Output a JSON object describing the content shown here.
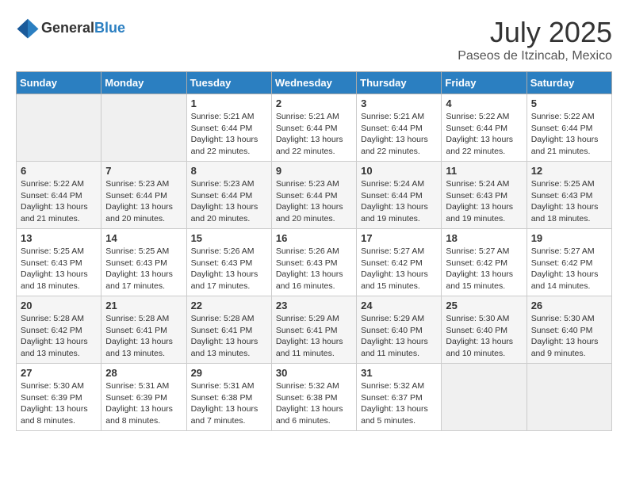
{
  "header": {
    "logo_general": "General",
    "logo_blue": "Blue",
    "month": "July 2025",
    "location": "Paseos de Itzincab, Mexico"
  },
  "weekdays": [
    "Sunday",
    "Monday",
    "Tuesday",
    "Wednesday",
    "Thursday",
    "Friday",
    "Saturday"
  ],
  "weeks": [
    [
      {
        "day": "",
        "sunrise": "",
        "sunset": "",
        "daylight": ""
      },
      {
        "day": "",
        "sunrise": "",
        "sunset": "",
        "daylight": ""
      },
      {
        "day": "1",
        "sunrise": "Sunrise: 5:21 AM",
        "sunset": "Sunset: 6:44 PM",
        "daylight": "Daylight: 13 hours and 22 minutes."
      },
      {
        "day": "2",
        "sunrise": "Sunrise: 5:21 AM",
        "sunset": "Sunset: 6:44 PM",
        "daylight": "Daylight: 13 hours and 22 minutes."
      },
      {
        "day": "3",
        "sunrise": "Sunrise: 5:21 AM",
        "sunset": "Sunset: 6:44 PM",
        "daylight": "Daylight: 13 hours and 22 minutes."
      },
      {
        "day": "4",
        "sunrise": "Sunrise: 5:22 AM",
        "sunset": "Sunset: 6:44 PM",
        "daylight": "Daylight: 13 hours and 22 minutes."
      },
      {
        "day": "5",
        "sunrise": "Sunrise: 5:22 AM",
        "sunset": "Sunset: 6:44 PM",
        "daylight": "Daylight: 13 hours and 21 minutes."
      }
    ],
    [
      {
        "day": "6",
        "sunrise": "Sunrise: 5:22 AM",
        "sunset": "Sunset: 6:44 PM",
        "daylight": "Daylight: 13 hours and 21 minutes."
      },
      {
        "day": "7",
        "sunrise": "Sunrise: 5:23 AM",
        "sunset": "Sunset: 6:44 PM",
        "daylight": "Daylight: 13 hours and 20 minutes."
      },
      {
        "day": "8",
        "sunrise": "Sunrise: 5:23 AM",
        "sunset": "Sunset: 6:44 PM",
        "daylight": "Daylight: 13 hours and 20 minutes."
      },
      {
        "day": "9",
        "sunrise": "Sunrise: 5:23 AM",
        "sunset": "Sunset: 6:44 PM",
        "daylight": "Daylight: 13 hours and 20 minutes."
      },
      {
        "day": "10",
        "sunrise": "Sunrise: 5:24 AM",
        "sunset": "Sunset: 6:44 PM",
        "daylight": "Daylight: 13 hours and 19 minutes."
      },
      {
        "day": "11",
        "sunrise": "Sunrise: 5:24 AM",
        "sunset": "Sunset: 6:43 PM",
        "daylight": "Daylight: 13 hours and 19 minutes."
      },
      {
        "day": "12",
        "sunrise": "Sunrise: 5:25 AM",
        "sunset": "Sunset: 6:43 PM",
        "daylight": "Daylight: 13 hours and 18 minutes."
      }
    ],
    [
      {
        "day": "13",
        "sunrise": "Sunrise: 5:25 AM",
        "sunset": "Sunset: 6:43 PM",
        "daylight": "Daylight: 13 hours and 18 minutes."
      },
      {
        "day": "14",
        "sunrise": "Sunrise: 5:25 AM",
        "sunset": "Sunset: 6:43 PM",
        "daylight": "Daylight: 13 hours and 17 minutes."
      },
      {
        "day": "15",
        "sunrise": "Sunrise: 5:26 AM",
        "sunset": "Sunset: 6:43 PM",
        "daylight": "Daylight: 13 hours and 17 minutes."
      },
      {
        "day": "16",
        "sunrise": "Sunrise: 5:26 AM",
        "sunset": "Sunset: 6:43 PM",
        "daylight": "Daylight: 13 hours and 16 minutes."
      },
      {
        "day": "17",
        "sunrise": "Sunrise: 5:27 AM",
        "sunset": "Sunset: 6:42 PM",
        "daylight": "Daylight: 13 hours and 15 minutes."
      },
      {
        "day": "18",
        "sunrise": "Sunrise: 5:27 AM",
        "sunset": "Sunset: 6:42 PM",
        "daylight": "Daylight: 13 hours and 15 minutes."
      },
      {
        "day": "19",
        "sunrise": "Sunrise: 5:27 AM",
        "sunset": "Sunset: 6:42 PM",
        "daylight": "Daylight: 13 hours and 14 minutes."
      }
    ],
    [
      {
        "day": "20",
        "sunrise": "Sunrise: 5:28 AM",
        "sunset": "Sunset: 6:42 PM",
        "daylight": "Daylight: 13 hours and 13 minutes."
      },
      {
        "day": "21",
        "sunrise": "Sunrise: 5:28 AM",
        "sunset": "Sunset: 6:41 PM",
        "daylight": "Daylight: 13 hours and 13 minutes."
      },
      {
        "day": "22",
        "sunrise": "Sunrise: 5:28 AM",
        "sunset": "Sunset: 6:41 PM",
        "daylight": "Daylight: 13 hours and 13 minutes."
      },
      {
        "day": "23",
        "sunrise": "Sunrise: 5:29 AM",
        "sunset": "Sunset: 6:41 PM",
        "daylight": "Daylight: 13 hours and 11 minutes."
      },
      {
        "day": "24",
        "sunrise": "Sunrise: 5:29 AM",
        "sunset": "Sunset: 6:40 PM",
        "daylight": "Daylight: 13 hours and 11 minutes."
      },
      {
        "day": "25",
        "sunrise": "Sunrise: 5:30 AM",
        "sunset": "Sunset: 6:40 PM",
        "daylight": "Daylight: 13 hours and 10 minutes."
      },
      {
        "day": "26",
        "sunrise": "Sunrise: 5:30 AM",
        "sunset": "Sunset: 6:40 PM",
        "daylight": "Daylight: 13 hours and 9 minutes."
      }
    ],
    [
      {
        "day": "27",
        "sunrise": "Sunrise: 5:30 AM",
        "sunset": "Sunset: 6:39 PM",
        "daylight": "Daylight: 13 hours and 8 minutes."
      },
      {
        "day": "28",
        "sunrise": "Sunrise: 5:31 AM",
        "sunset": "Sunset: 6:39 PM",
        "daylight": "Daylight: 13 hours and 8 minutes."
      },
      {
        "day": "29",
        "sunrise": "Sunrise: 5:31 AM",
        "sunset": "Sunset: 6:38 PM",
        "daylight": "Daylight: 13 hours and 7 minutes."
      },
      {
        "day": "30",
        "sunrise": "Sunrise: 5:32 AM",
        "sunset": "Sunset: 6:38 PM",
        "daylight": "Daylight: 13 hours and 6 minutes."
      },
      {
        "day": "31",
        "sunrise": "Sunrise: 5:32 AM",
        "sunset": "Sunset: 6:37 PM",
        "daylight": "Daylight: 13 hours and 5 minutes."
      },
      {
        "day": "",
        "sunrise": "",
        "sunset": "",
        "daylight": ""
      },
      {
        "day": "",
        "sunrise": "",
        "sunset": "",
        "daylight": ""
      }
    ]
  ]
}
